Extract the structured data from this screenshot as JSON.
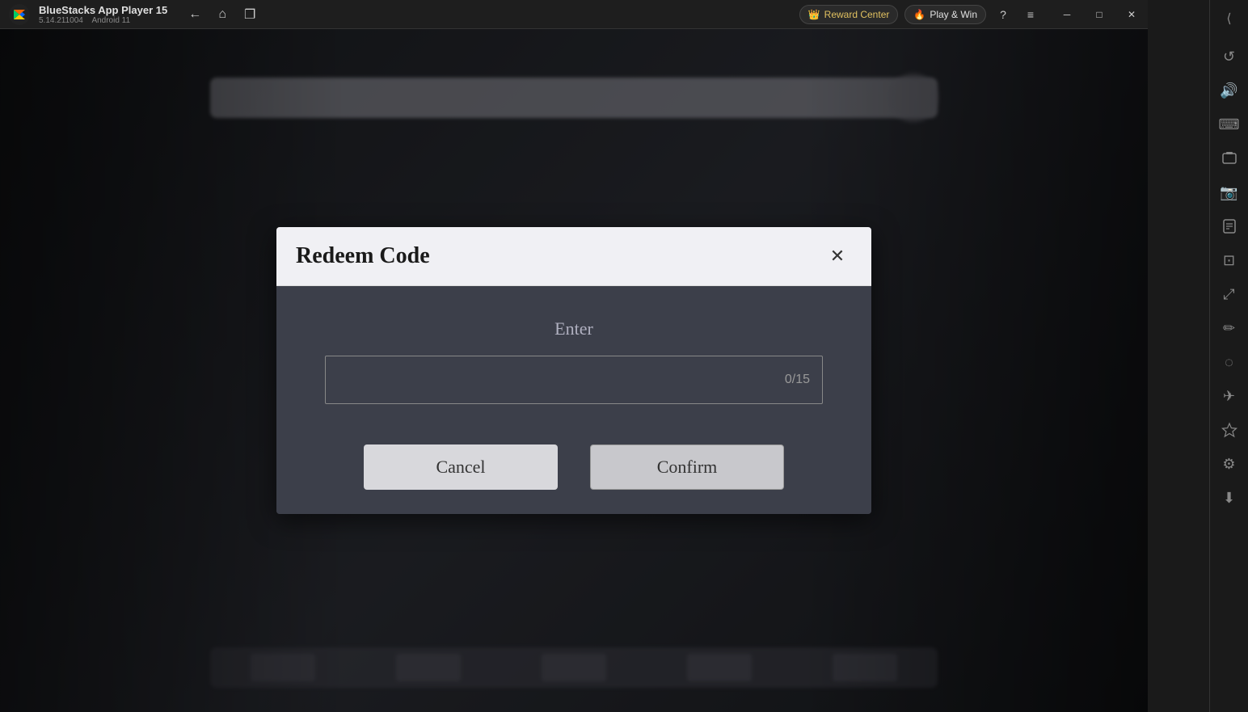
{
  "app": {
    "name": "BlueStacks App Player 15",
    "version": "5.14.211004",
    "android": "Android 11"
  },
  "titlebar": {
    "back_label": "←",
    "home_label": "⌂",
    "copy_label": "❐",
    "reward_label": "Reward Center",
    "play_win_label": "Play & Win",
    "help_label": "?",
    "menu_label": "≡",
    "minimize_label": "─",
    "maximize_label": "□",
    "close_label": "✕",
    "expand_label": "⟩"
  },
  "sidebar": {
    "icons": [
      {
        "name": "expand-icon",
        "symbol": "⟩"
      },
      {
        "name": "rotate-icon",
        "symbol": "↺"
      },
      {
        "name": "volume-icon",
        "symbol": "♪"
      },
      {
        "name": "keyboard-icon",
        "symbol": "⌨"
      },
      {
        "name": "screenshot-icon",
        "symbol": "⬛"
      },
      {
        "name": "camera-icon",
        "symbol": "◎"
      },
      {
        "name": "apk-icon",
        "symbol": "❑"
      },
      {
        "name": "crop-icon",
        "symbol": "⊡"
      },
      {
        "name": "fullscreen-icon",
        "symbol": "⤢"
      },
      {
        "name": "edit-icon",
        "symbol": "✏"
      },
      {
        "name": "eraser-icon",
        "symbol": "◌"
      },
      {
        "name": "plane-icon",
        "symbol": "✈"
      },
      {
        "name": "star-icon",
        "symbol": "★"
      },
      {
        "name": "settings-icon",
        "symbol": "⚙"
      },
      {
        "name": "download-icon",
        "symbol": "⬇"
      }
    ]
  },
  "dialog": {
    "title": "Redeem Code",
    "close_label": "✕",
    "enter_label": "Enter",
    "input_placeholder": "",
    "input_counter": "0/15",
    "cancel_label": "Cancel",
    "confirm_label": "Confirm"
  }
}
